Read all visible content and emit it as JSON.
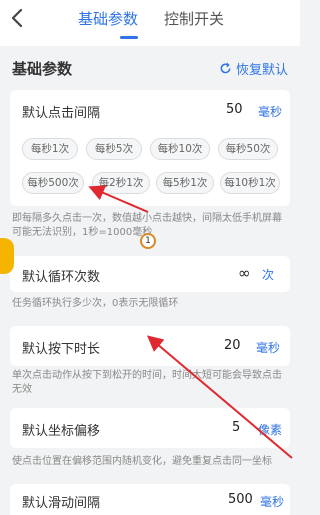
{
  "tabs": [
    {
      "label": "基础参数",
      "active": true
    },
    {
      "label": "控制开关",
      "active": false
    }
  ],
  "section": {
    "title": "基础参数",
    "restore_label": "恢复默认"
  },
  "interval": {
    "label": "默认点击间隔",
    "value": "50",
    "unit": "毫秒",
    "presets": [
      "每秒1次",
      "每秒5次",
      "每秒10次",
      "每秒50次",
      "每秒500次",
      "每2秒1次",
      "每5秒1次",
      "每10秒1次"
    ],
    "hint": "即每隔多久点击一次，数值越小点击越快，间隔太低手机屏幕可能无法识别，1秒=1000毫秒"
  },
  "loop": {
    "label": "默认循环次数",
    "value": "∞",
    "unit": "次",
    "hint": "任务循环执行多少次，0表示无限循环"
  },
  "press": {
    "label": "默认按下时长",
    "value": "20",
    "unit": "毫秒",
    "hint": "单次点击动作从按下到松开的时间，时间太短可能会导致点击无效"
  },
  "offset": {
    "label": "默认坐标偏移",
    "value": "5",
    "unit": "像素",
    "hint": "使点击位置在偏移范围内随机变化，避免重复点击同一坐标"
  },
  "swipe": {
    "label": "默认滑动间隔",
    "value": "500",
    "unit": "毫秒"
  },
  "marker_number": "1",
  "colors": {
    "accent": "#2f74e6",
    "arrow": "#e0282e",
    "background": "#f2f3f5"
  }
}
